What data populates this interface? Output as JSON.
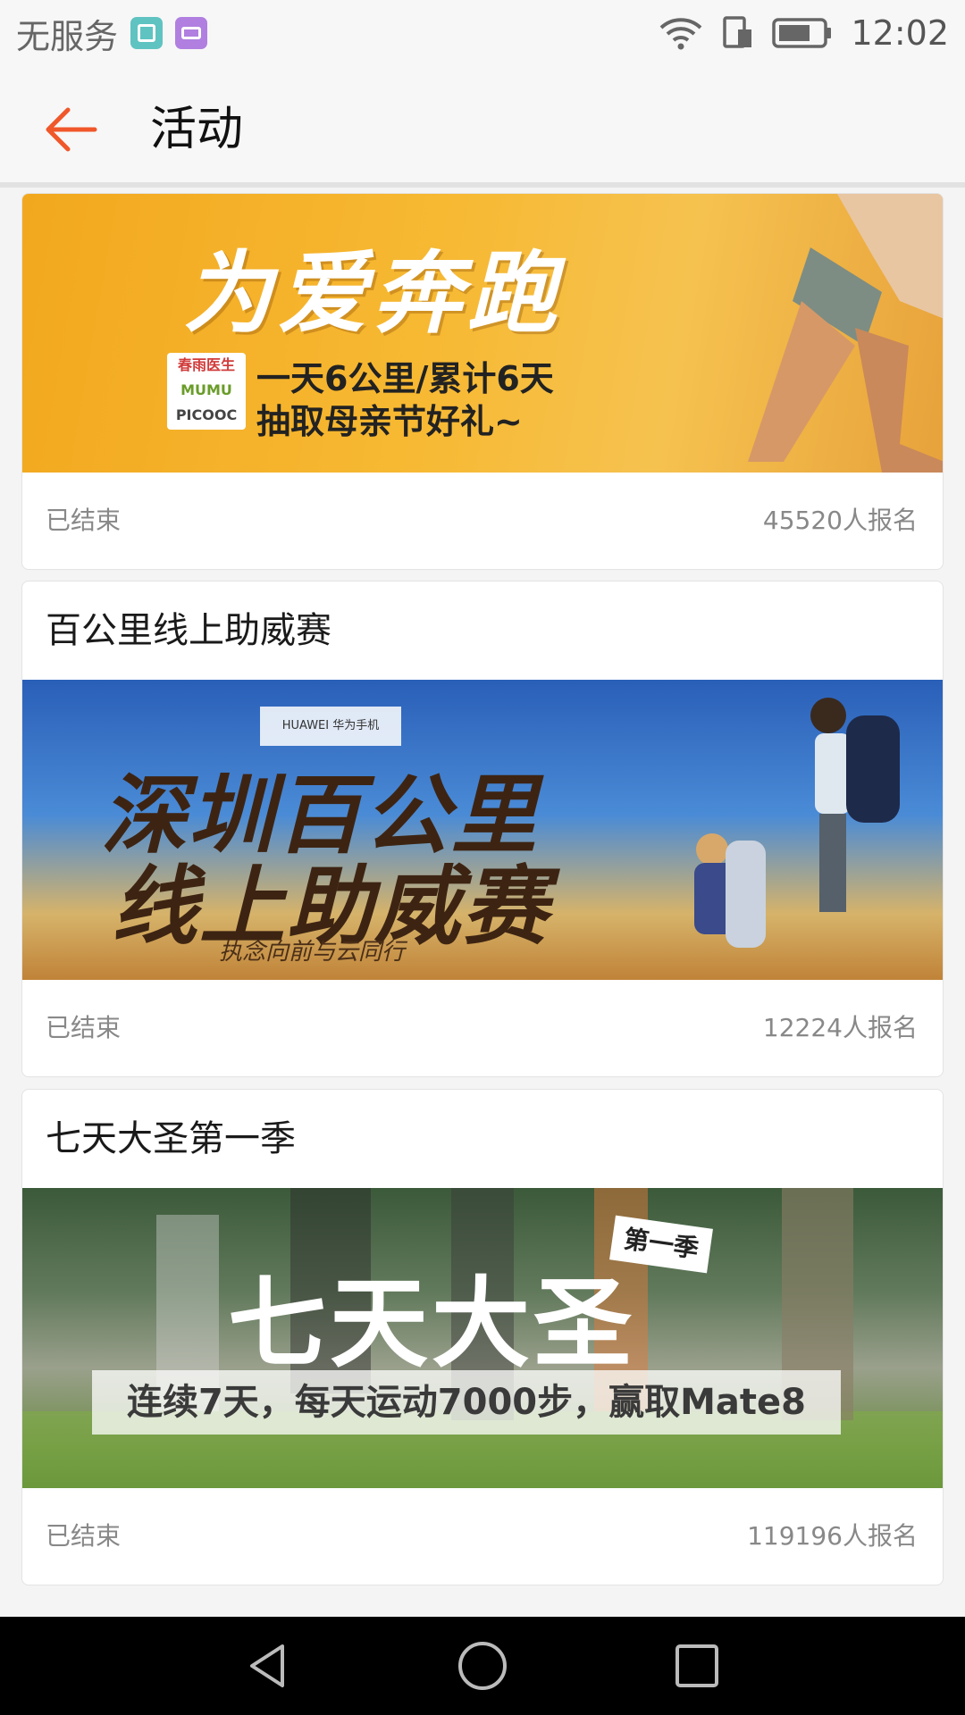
{
  "status_bar": {
    "carrier": "无服务",
    "time": "12:02",
    "icons": [
      "gallery-app-icon",
      "keyboard-app-icon",
      "wifi-icon",
      "sim-icon",
      "battery-icon"
    ]
  },
  "header": {
    "title": "活动",
    "back_icon": "back-arrow-icon",
    "accent": "#f0572a"
  },
  "activities": [
    {
      "title": "",
      "banner": {
        "headline": "为爱奔跑",
        "line1": "一天6公里/累计6天",
        "line2": "抽取母亲节好礼~",
        "partners": [
          "春雨医生",
          "MUMU",
          "PICOOC"
        ]
      },
      "status": "已结束",
      "signups": "45520人报名"
    },
    {
      "title": "百公里线上助威赛",
      "banner": {
        "brand": "HUAWEI 华为手机",
        "line1": "深圳百公里",
        "line2": "线上助威赛",
        "slogan": "执念向前与云同行"
      },
      "status": "已结束",
      "signups": "12224人报名"
    },
    {
      "title": "七天大圣第一季",
      "banner": {
        "headline": "七天大圣",
        "season": "第一季",
        "strip": "连续7天，每天运动7000步，赢取Mate8"
      },
      "status": "已结束",
      "signups": "119196人报名"
    }
  ],
  "nav_bar": {
    "icons": [
      "nav-back-icon",
      "nav-home-icon",
      "nav-recents-icon"
    ]
  }
}
